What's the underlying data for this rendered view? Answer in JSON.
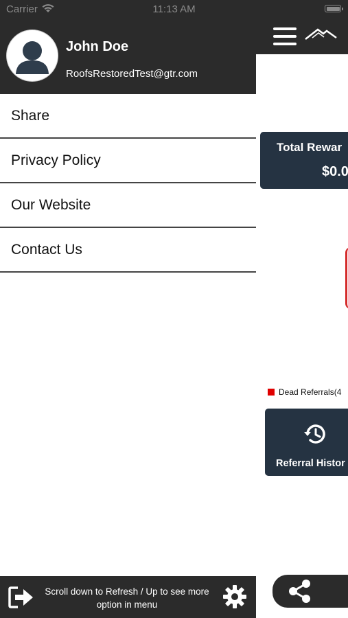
{
  "status_bar": {
    "carrier": "Carrier",
    "time": "11:13 AM"
  },
  "drawer": {
    "user": {
      "name": "John Doe",
      "email": "RoofsRestoredTest@gtr.com"
    },
    "menu": [
      {
        "label": "Share"
      },
      {
        "label": "Privacy Policy"
      },
      {
        "label": "Our Website"
      },
      {
        "label": "Contact Us"
      }
    ],
    "footer": {
      "hint_line1": "Scroll down to Refresh / Up to see more",
      "hint_line2": "option in menu"
    }
  },
  "main": {
    "rewards": {
      "title": "Total Rewar",
      "amount": "$0.0"
    },
    "legend": {
      "label": "Dead Referrals(4"
    },
    "history": {
      "label": "Referral Histor"
    }
  },
  "icons": {
    "menu": "hamburger-icon",
    "logo": "roof-logo-icon",
    "avatar": "user-avatar-icon",
    "logout": "logout-icon",
    "settings": "gear-icon",
    "history": "history-icon",
    "share": "share-icon"
  },
  "colors": {
    "header": "#2b2b2b",
    "card": "#253342",
    "accent_red": "#e00000",
    "divider": "#444444"
  }
}
